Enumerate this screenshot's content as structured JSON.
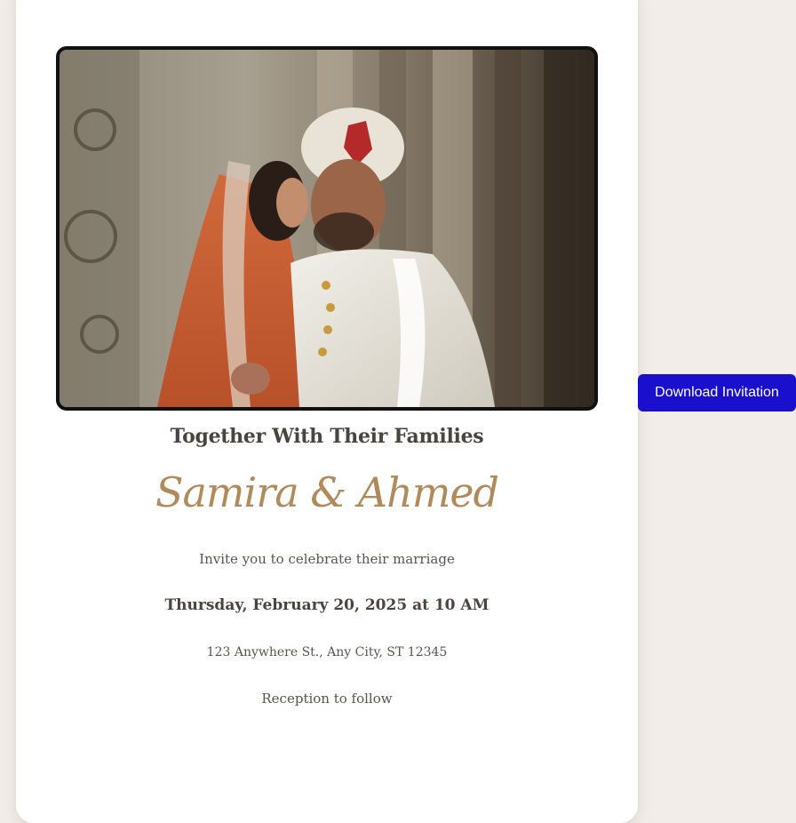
{
  "invitation": {
    "heading": "Together With Their Families",
    "names": "Samira & Ahmed",
    "invite_text": "Invite you to celebrate their marriage",
    "date_time": "Thursday, February 20, 2025 at 10 AM",
    "address": "123 Anywhere St., Any City, ST 12345",
    "reception": "Reception to follow"
  },
  "actions": {
    "download_label": "Download Invitation"
  },
  "colors": {
    "page_background": "#f2ede8",
    "card_background": "#ffffff",
    "names_accent": "#b08a5a",
    "button_background": "#1a0fcc",
    "text_dark": "#4a4440"
  }
}
